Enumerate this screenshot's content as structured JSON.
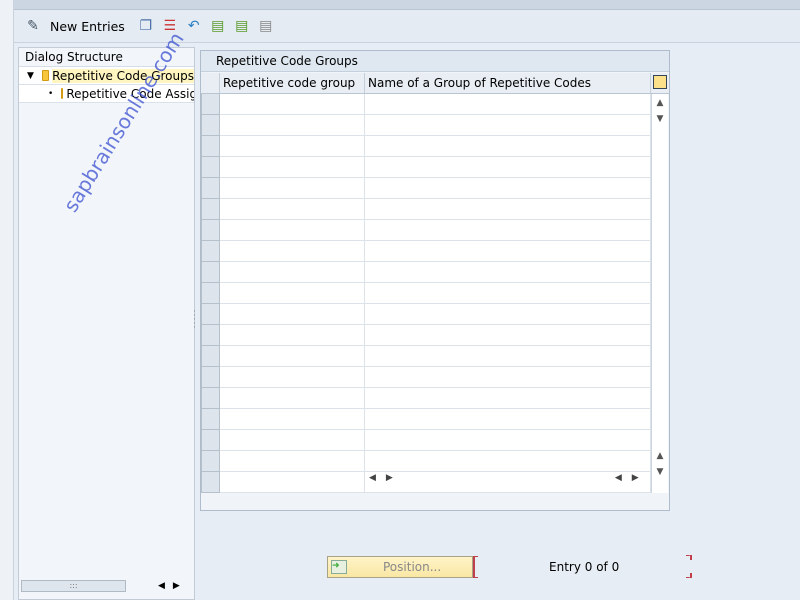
{
  "toolbar": {
    "new_entries": "New Entries",
    "icons": [
      "display-change-icon",
      "copy-icon",
      "delete-icon",
      "undo-icon",
      "select-all-icon",
      "select-block-icon",
      "deselect-all-icon"
    ]
  },
  "dialog": {
    "title": "Dialog Structure",
    "items": [
      {
        "label": "Repetitive Code Groups",
        "selected": true
      },
      {
        "label": "Repetitive Code Assignment"
      }
    ]
  },
  "table": {
    "title": "Repetitive Code Groups",
    "columns": [
      "Repetitive code group",
      "Name of a Group of Repetitive Codes"
    ]
  },
  "footer": {
    "position": "Position...",
    "entry": "Entry 0 of 0"
  },
  "watermark": "sapbrainsonline.com"
}
